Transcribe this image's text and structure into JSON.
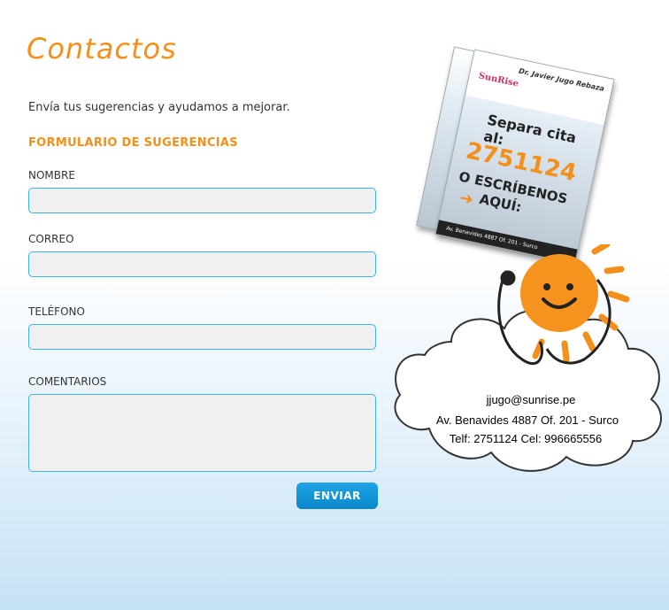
{
  "page": {
    "title": "Contactos",
    "intro": "Envía tus sugerencias y ayudamos a mejorar.",
    "section_heading": "FORMULARIO DE SUGERENCIAS"
  },
  "form": {
    "fields": [
      {
        "label": "NOMBRE",
        "value": ""
      },
      {
        "label": "CORREO",
        "value": ""
      },
      {
        "label": "TELÉFONO",
        "value": ""
      },
      {
        "label": "COMENTARIOS",
        "value": ""
      }
    ],
    "submit_label": "ENVIAR"
  },
  "flyer": {
    "brand": "SunRise",
    "doctor": "Dr. Javier Jugo Rebaza",
    "cta_line1": "Separa cita al:",
    "phone": "2751124",
    "cta_line2": "O ESCRÍBENOS",
    "cta_line3": "AQUÍ:",
    "footer": "Av. Benavides 4887 Of. 201 - Surco"
  },
  "contact": {
    "email": "jjugo@sunrise.pe",
    "address": "Av. Benavides 4887 Of. 201 -  Surco",
    "phones": "Telf: 2751124   Cel: 996665556"
  },
  "colors": {
    "accent": "#f39019",
    "field_border": "#3bb4e8",
    "button": "#0a86c9"
  }
}
